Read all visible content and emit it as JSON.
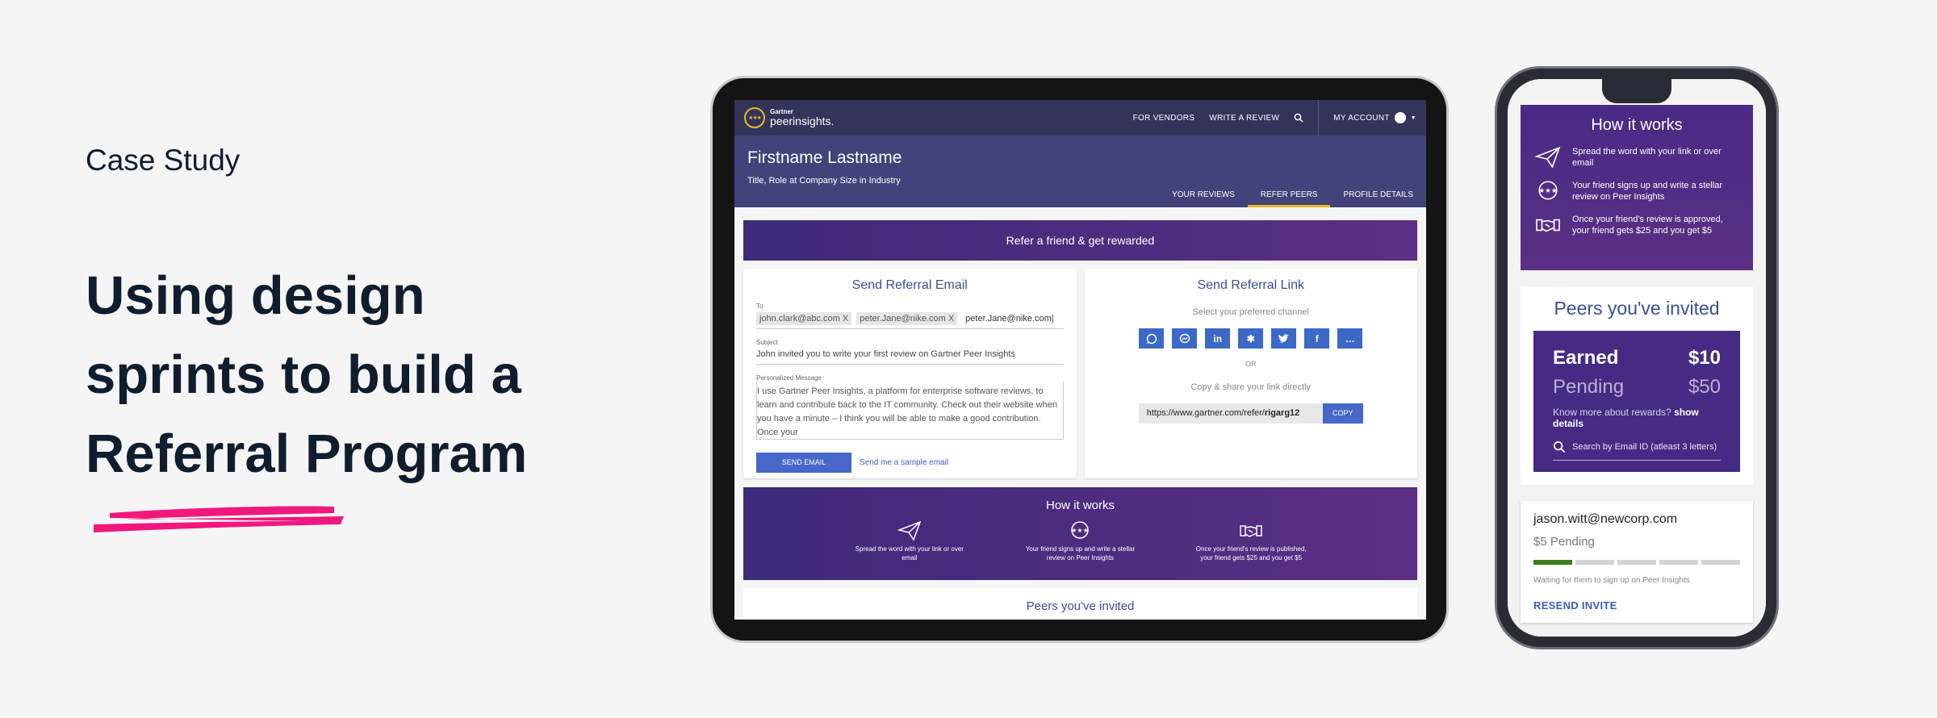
{
  "intro": {
    "eyebrow": "Case Study",
    "headline_lines": [
      "Using design",
      "sprints to build a",
      "Referral Program"
    ],
    "accent_color": "#f0187e"
  },
  "tablet": {
    "logo": {
      "line1": "Gartner",
      "line2": "peerinsights."
    },
    "nav": {
      "vendors": "FOR VENDORS",
      "write_review": "WRITE A REVIEW",
      "account": "MY ACCOUNT"
    },
    "profile": {
      "name": "Firstname Lastname",
      "role": "Title, Role at Company Size in Industry"
    },
    "tabs": [
      "YOUR REVIEWS",
      "REFER PEERS",
      "PROFILE DETAILS"
    ],
    "active_tab": "REFER PEERS",
    "banner": "Refer a friend & get rewarded",
    "email_card": {
      "title": "Send Referral Email",
      "to_label": "To",
      "chips": [
        "john.clark@abc.com X",
        "peter.Jane@nike.com X"
      ],
      "to_input": "peter.Jane@nike.com|",
      "subject_label": "Subject",
      "subject": "John invited you to write your first review on Gartner Peer Insights",
      "message_label": "Personalized Message",
      "message": "I use Gartner Peer Insights, a platform for enterprise software reviews, to learn and contribute back to the IT community. Check out their website when you have a minute – I think you will be able to make a good contribution. Once your",
      "send_button": "SEND EMAIL",
      "sample_link": "Send me a sample email"
    },
    "link_card": {
      "title": "Send Referral Link",
      "channel_label": "Select your preferred channel",
      "channels": [
        "whatsapp",
        "messenger",
        "linkedin",
        "slack",
        "twitter",
        "facebook",
        "more"
      ],
      "or": "OR",
      "copy_label": "Copy & share your link directly",
      "link_prefix": "https://www.gartner.com/refer/",
      "link_code": "rigarg12",
      "copy_button": "COPY"
    },
    "how": {
      "title": "How it works",
      "steps": [
        "Spread the word with your link or over email",
        "Your friend signs up and write a stellar review on Peer Insights",
        "Once your friend's review is published, your friend gets $25 and you get $5"
      ]
    },
    "peers_title": "Peers you've invited"
  },
  "phone": {
    "how": {
      "title": "How it works",
      "steps": [
        "Spread the word with your link or over email",
        "Your friend signs up and write a stellar review on Peer Insights",
        "Once your friend's review is approved, your friend gets $25 and you get $5"
      ]
    },
    "peers_title": "Peers you've invited",
    "earned_label": "Earned",
    "earned_value": "$10",
    "pending_label": "Pending",
    "pending_value": "$50",
    "rewards_prefix": "Know more about rewards?",
    "rewards_link": "show details",
    "search_placeholder": "Search by Email ID (atleast 3 letters)",
    "invite": {
      "email": "jason.witt@newcorp.com",
      "status": "$5 Pending",
      "progress_steps": 5,
      "progress_done": 1,
      "note": "Waiting for them to sign up on Peer Insights",
      "resend": "RESEND INVITE"
    }
  }
}
